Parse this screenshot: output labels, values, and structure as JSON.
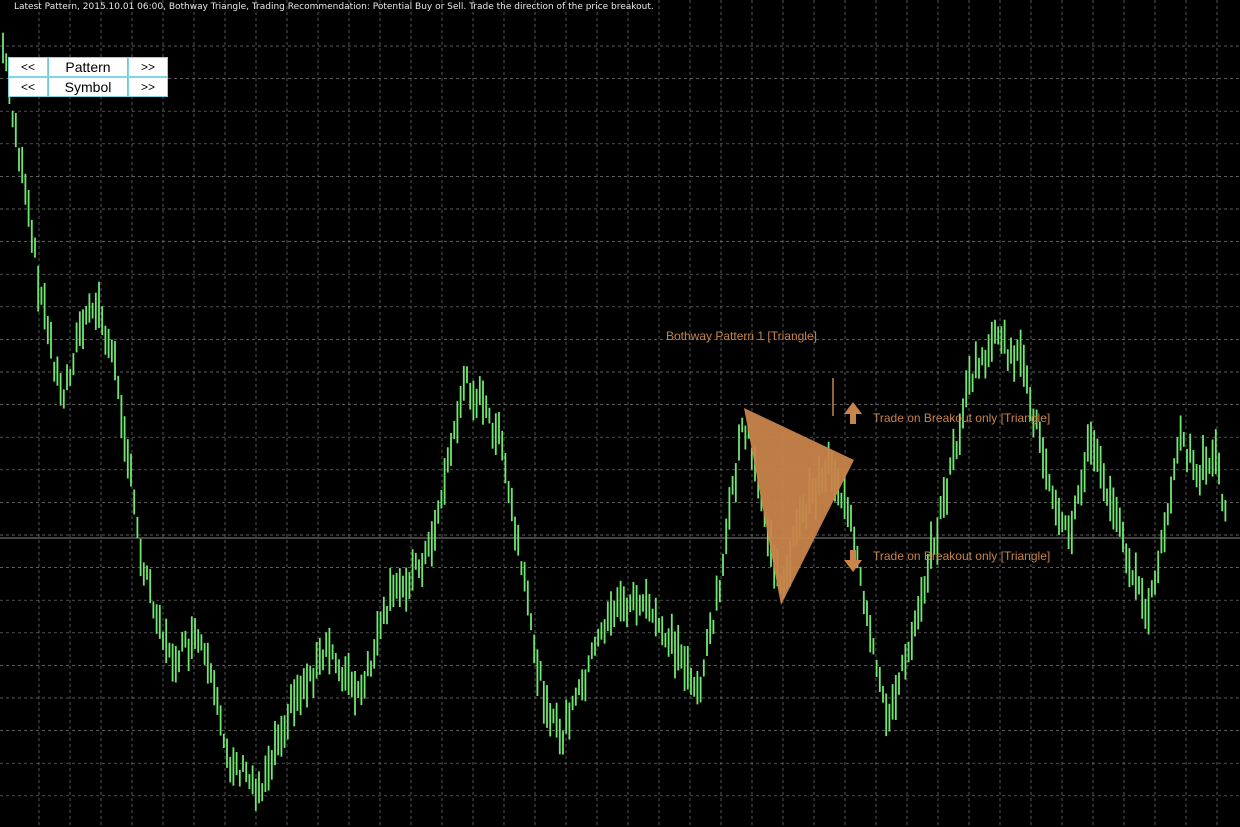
{
  "status": {
    "text": "Latest Pattern, 2015.10.01 06:00, Bothway Triangle, Trading Recommendation: Potential Buy or Sell. Trade the direction of the price breakout."
  },
  "nav": {
    "pattern": {
      "prev": "<<",
      "label": "Pattern",
      "next": ">>"
    },
    "symbol": {
      "prev": "<<",
      "label": "Symbol",
      "next": ">>"
    }
  },
  "annotations": {
    "pattern_name": "Bothway Pattern 1  [Triangle]",
    "buy_note": "Trade on Breakout only [Triangle]",
    "sell_note": "Trade on Breakout only [Triangle]"
  },
  "colors": {
    "background": "#000000",
    "grid": "#7a7a7a",
    "bars": "#6ee86e",
    "pattern": "#c8844a",
    "nav_border": "#7fd6e8"
  },
  "icons": {
    "buy": "arrow-up-icon",
    "sell": "arrow-down-icon"
  }
}
